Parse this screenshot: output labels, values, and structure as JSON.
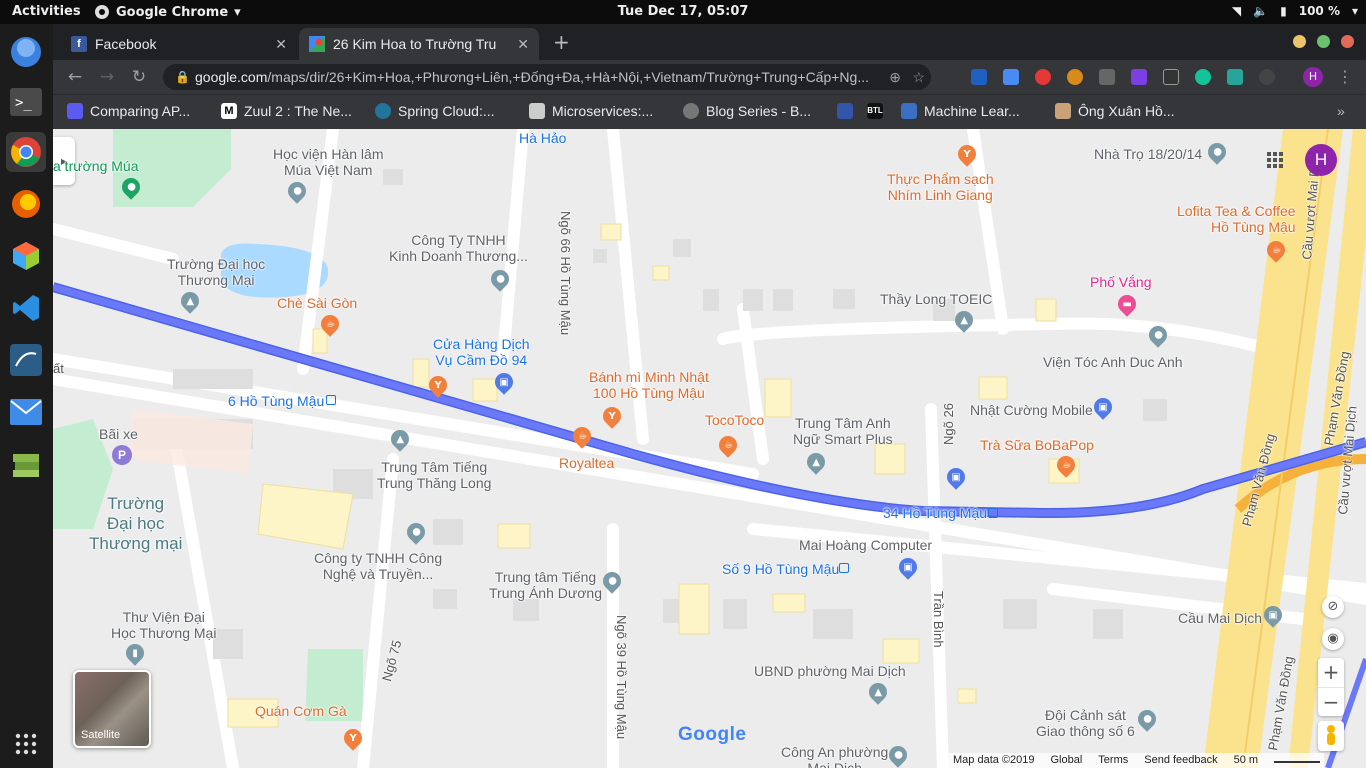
{
  "topbar": {
    "activities": "Activities",
    "app_name": "Google Chrome",
    "clock": "Tue Dec 17, 05:07",
    "battery": "100 %"
  },
  "tabs": [
    {
      "title": "Facebook"
    },
    {
      "title": "26 Kim Hoa to Trường Tru"
    }
  ],
  "omnibox": {
    "host": "google.com",
    "path": "/maps/dir/26+Kim+Hoa,+Phương+Liên,+Đống+Đa,+Hà+Nội,+Vietnam/Trường+Trung+Cấp+Ng..."
  },
  "profile_letter": "H",
  "bookmarks": [
    {
      "label": "Comparing AP..."
    },
    {
      "label": "Zuul 2 : The Ne..."
    },
    {
      "label": "Spring Cloud:..."
    },
    {
      "label": "Microservices:..."
    },
    {
      "label": "Blog Series - B..."
    },
    {
      "label": "Machine Lear..."
    },
    {
      "label": "Ông Xuân Hồ..."
    }
  ],
  "map": {
    "places": [
      {
        "name": "Hà Hảo"
      },
      {
        "name": "Học viện Hàn lâm\nMúa Việt Nam"
      },
      {
        "name": "a trường Múa"
      },
      {
        "name": "Công Ty TNHH\nKinh Doanh Thương..."
      },
      {
        "name": "Trường Đại học\nThương Mại"
      },
      {
        "name": "Chè Sài Gòn"
      },
      {
        "name": "Cửa Hàng Dịch\nVụ Cầm Đồ 94"
      },
      {
        "name": "Bánh mì Minh Nhật\n100 Hồ Tùng Mậu"
      },
      {
        "name": "TocoToco"
      },
      {
        "name": "Royaltea"
      },
      {
        "name": "Trung Tâm Anh\nNgữ Smart Plus"
      },
      {
        "name": "Thực Phẩm sạch\nNhím Linh Giang"
      },
      {
        "name": "Nhà Trọ 18/20/14"
      },
      {
        "name": "Lofita Tea & Coffee\nHồ Tùng Mậu"
      },
      {
        "name": "Phố Vắng"
      },
      {
        "name": "Thầy Long TOEIC"
      },
      {
        "name": "Viện Tóc Anh Duc Anh"
      },
      {
        "name": "Nhật Cường Mobile"
      },
      {
        "name": "Trà Sữa BoBaPop"
      },
      {
        "name": "Bãi xe"
      },
      {
        "name": "Trường\nĐại học\nThương mại"
      },
      {
        "name": "Trung Tâm Tiếng\nTrung Thăng Long"
      },
      {
        "name": "Công ty TNHH Công\nNghệ và Truyền..."
      },
      {
        "name": "Trung tâm Tiếng\nTrung Ánh Dương"
      },
      {
        "name": "Mai Hoàng Computer"
      },
      {
        "name": "Thư Viện Đại\nHọc Thương Mại"
      },
      {
        "name": "UBND phường Mai Dịch"
      },
      {
        "name": "Cầu Mai Dịch"
      },
      {
        "name": "Đội Cảnh sát\nGiao thông số 6"
      },
      {
        "name": "Quán Cơm Gà"
      },
      {
        "name": "Công An phường\nMai Dịch"
      }
    ],
    "stops": [
      {
        "name": "6 Hồ Tùng Mậu"
      },
      {
        "name": "34 Hồ Tùng Mậu"
      },
      {
        "name": "Số 9 Hồ Tùng Mậu"
      }
    ],
    "streets": [
      {
        "name": "Ngõ 66 Hồ Tùng Mậu"
      },
      {
        "name": "Ngõ 26"
      },
      {
        "name": "Trần Bình"
      },
      {
        "name": "Ngõ 75"
      },
      {
        "name": "Ngõ 39 Hồ Tùng Mậu"
      },
      {
        "name": "Phạm Văn Đồng"
      },
      {
        "name": "Cầu vượt Mai Dịch"
      },
      {
        "name": "ất"
      }
    ],
    "satellite_label": "Satellite",
    "google_logo": "Google",
    "footer": {
      "map_data": "Map data ©2019",
      "global": "Global",
      "terms": "Terms",
      "feedback": "Send feedback",
      "scale": "50 m"
    }
  },
  "colors": {
    "route": "#6b78f7",
    "park": "#c4ecd0",
    "water": "#aadaff",
    "highway": "#fbe38d"
  }
}
